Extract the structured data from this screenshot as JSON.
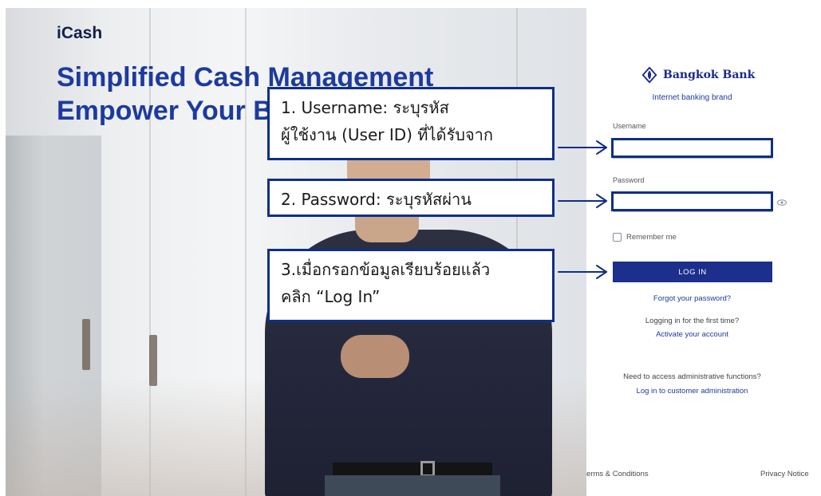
{
  "hero": {
    "brand": "iCash",
    "title_line1": "Simplified Cash Management",
    "title_line2": "Empower Your B"
  },
  "login": {
    "logo_text": "Bangkok Bank",
    "brand_tagline": "Internet banking brand",
    "username_label": "Username",
    "username_value": "",
    "password_label": "Password",
    "password_value": "",
    "remember_label": "Remember me",
    "remember_checked": false,
    "login_button": "LOG IN",
    "forgot_password": "Forgot your password?",
    "first_time_text": "Logging in for the first time?",
    "activate_link": "Activate your account",
    "admin_text": "Need to access administrative functions?",
    "admin_link": "Log in to customer administration",
    "terms_link": "erms & Conditions",
    "privacy_link": "Privacy Notice"
  },
  "callouts": {
    "username_line1": "1. Username: ระบุรหัส",
    "username_line2": "ผู้ใช้งาน (User ID) ที่ได้รับจาก",
    "password_line1": "2. Password: ระบุรหัสผ่าน",
    "login_line1": "3.เมื่อกรอกข้อมูลเรียบร้อยแล้ว",
    "login_line2": "คลิก “Log In”"
  },
  "colors": {
    "brand_blue": "#1d2f8c",
    "callout_border": "#0f2f86",
    "link_blue": "#1d3a9e"
  },
  "icons": {
    "logo": "bangkok-bank-lotus-icon",
    "show_password": "eye-icon",
    "pointer": "arrow-right-icon"
  }
}
